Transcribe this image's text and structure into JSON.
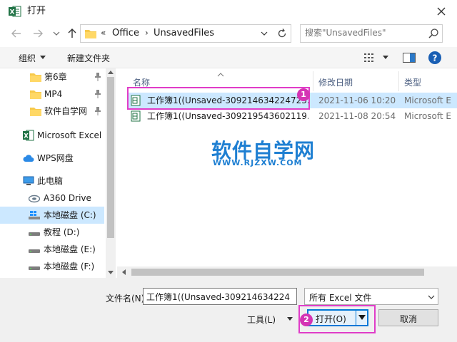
{
  "window": {
    "title": "打开",
    "app_icon": "excel-app-icon"
  },
  "nav": {
    "breadcrumb_chevrons": "«",
    "crumbs": [
      "Office",
      "UnsavedFiles"
    ],
    "crumb_separator": "›",
    "search_placeholder": "搜索\"UnsavedFiles\""
  },
  "toolbar": {
    "organize_label": "组织",
    "new_folder_label": "新建文件夹"
  },
  "sidebar": {
    "items": [
      {
        "label": "第6章",
        "icon": "folder-icon",
        "pinned": true
      },
      {
        "label": "MP4",
        "icon": "folder-icon",
        "pinned": true
      },
      {
        "label": "软件自学网",
        "icon": "folder-icon",
        "pinned": true
      },
      {
        "label": "Microsoft Excel",
        "icon": "excel-icon",
        "pinned": false
      },
      {
        "label": "WPS网盘",
        "icon": "cloud-icon",
        "pinned": false
      },
      {
        "label": "此电脑",
        "icon": "computer-icon",
        "pinned": false
      },
      {
        "label": "A360 Drive",
        "icon": "drive-icon",
        "pinned": false
      },
      {
        "label": "本地磁盘 (C:)",
        "icon": "windows-drive-icon",
        "pinned": false,
        "selected": true
      },
      {
        "label": "教程 (D:)",
        "icon": "disk-icon",
        "pinned": false
      },
      {
        "label": "本地磁盘 (E:)",
        "icon": "disk-icon",
        "pinned": false
      },
      {
        "label": "本地磁盘 (F:)",
        "icon": "disk-icon",
        "pinned": false
      }
    ]
  },
  "filelist": {
    "columns": [
      "名称",
      "修改日期",
      "类型"
    ],
    "rows": [
      {
        "name": "工作簿1((Unsaved-309214634224723...",
        "date": "2021-11-06 10:20",
        "type": "Microsoft E",
        "selected": true
      },
      {
        "name": "工作簿1((Unsaved-309219543602119...",
        "date": "2021-11-08 20:54",
        "type": "Microsoft E",
        "selected": false
      }
    ]
  },
  "watermark": {
    "title": "软件自学网",
    "url": "WWW.RJZXW.COM"
  },
  "bottom": {
    "filename_label": "文件名(N):",
    "filename_value": "工作簿1((Unsaved-309214634224",
    "filter_value": "所有 Excel 文件",
    "tools_label": "工具(L)",
    "open_label": "打开(O)",
    "cancel_label": "取消"
  },
  "annotations": [
    "1",
    "2"
  ],
  "colors": {
    "accent": "#0078d7",
    "selection": "#cce8ff",
    "annotation": "#e03cc8",
    "watermark": "#1e7fd2",
    "excel_green": "#217346"
  }
}
